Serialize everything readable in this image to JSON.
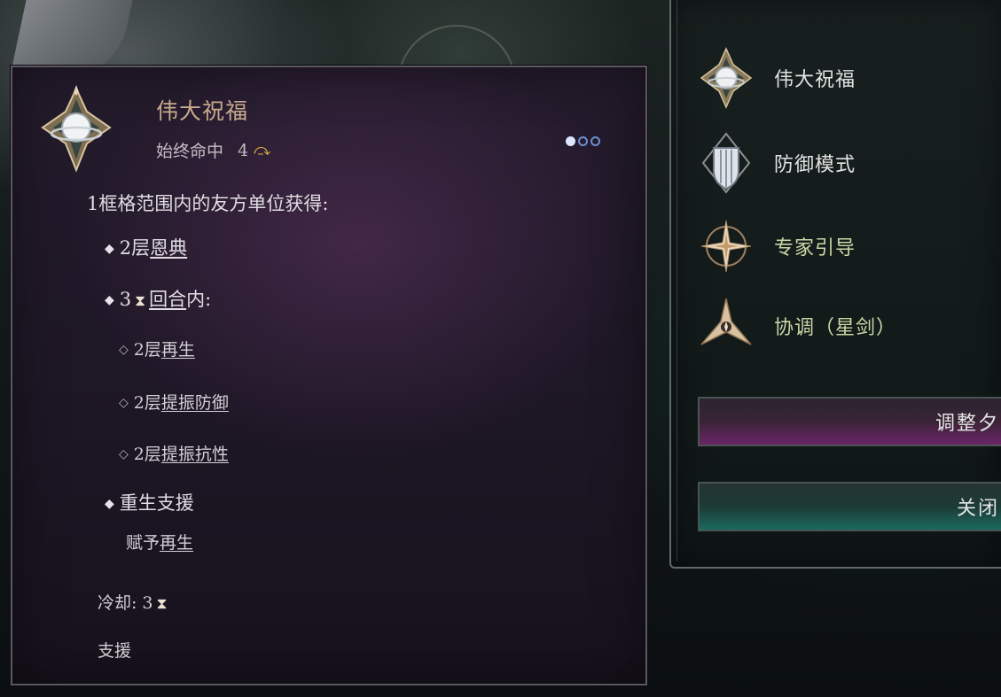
{
  "tooltip": {
    "title": "伟大祝福",
    "subtitle": "始终命中",
    "range_value": "4",
    "charges": [
      true,
      false,
      false
    ],
    "intro": "1框格范围内的友方单位获得:",
    "lines": {
      "grace_prefix": "2层",
      "grace_link": "恩典",
      "turns_num": "3",
      "turns_link": "回合",
      "turns_suffix": "内:",
      "regen_prefix": "2层",
      "regen_link": "再生",
      "def_prefix": "2层",
      "def_link": "提振防御",
      "res_prefix": "2层",
      "res_link": "提振抗性",
      "rebirth_title": "重生支援",
      "rebirth_prefix": "赋予",
      "rebirth_link": "再生",
      "cooldown_label": "冷却:",
      "cooldown_value": "3",
      "category": "支援"
    }
  },
  "skills": [
    {
      "label": "伟大祝福",
      "icon": "sun-blessing-icon"
    },
    {
      "label": "防御模式",
      "icon": "shield-mode-icon"
    },
    {
      "label": "专家引导",
      "icon": "compass-star-icon"
    },
    {
      "label": "协调（星剑）",
      "icon": "star-sword-icon"
    }
  ],
  "buttons": {
    "adjust_label": "调整夕",
    "close_label": "关闭"
  },
  "colors": {
    "title_gold": "#c7a98d",
    "adjust_magenta": "#6b2468",
    "close_teal": "#1b6a5e",
    "charge_blue": "#6d8fd3"
  }
}
